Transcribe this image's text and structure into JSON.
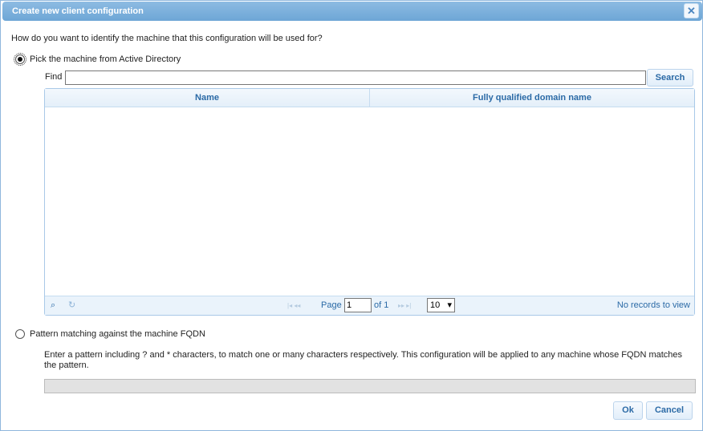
{
  "dialog": {
    "title": "Create new client configuration",
    "close_icon": "close-icon"
  },
  "question": "How do you want to identify the machine that this configuration will be used for?",
  "option_ad": {
    "label": "Pick the machine from Active Directory",
    "selected": true
  },
  "find": {
    "label": "Find",
    "value": "",
    "search_label": "Search"
  },
  "grid": {
    "columns": [
      "Name",
      "Fully qualified domain name"
    ],
    "rows": [],
    "pager": {
      "page_label": "Page",
      "page_value": "1",
      "of_label": "of 1",
      "page_size": "10",
      "status": "No records to view"
    }
  },
  "option_pattern": {
    "label": "Pattern matching against the machine FQDN",
    "selected": false,
    "help": "Enter a pattern including ? and * characters, to match one or many characters respectively. This configuration will be applied to any machine whose FQDN matches the pattern.",
    "value": ""
  },
  "buttons": {
    "ok": "Ok",
    "cancel": "Cancel"
  }
}
